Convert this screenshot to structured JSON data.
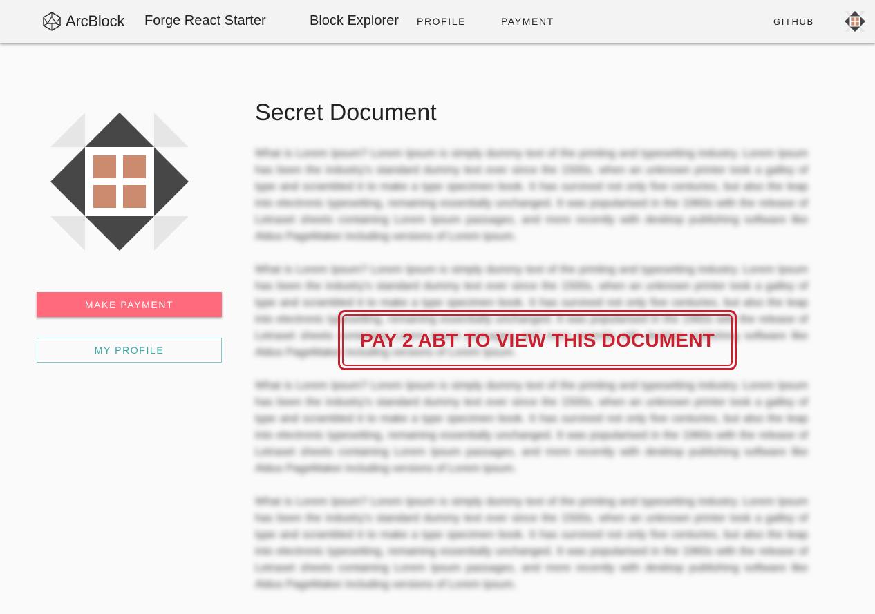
{
  "header": {
    "brand": "ArcBlock",
    "app_title": "Forge React Starter",
    "nav": {
      "explorer": "Block Explorer",
      "profile": "PROFILE",
      "payment": "PAYMENT",
      "github": "GITHUB"
    }
  },
  "colors": {
    "avatar_dark": "#474747",
    "avatar_light": "#e6e6e6",
    "avatar_accent": "#cc8a6e",
    "primary_button": "#ff6b7c",
    "outline_button": "#7ccaca",
    "stamp": "#c8202f"
  },
  "sidebar": {
    "make_payment": "MAKE PAYMENT",
    "my_profile": "MY PROFILE"
  },
  "document": {
    "title": "Secret Document",
    "paragraphs": [
      "What is Lorem Ipsum? Lorem Ipsum is simply dummy text of the printing and typesetting industry. Lorem Ipsum has been the industry's standard dummy text ever since the 1500s, when an unknown printer took a galley of type and scrambled it to make a type specimen book. It has survived not only five centuries, but also the leap into electronic typesetting, remaining essentially unchanged. It was popularised in the 1960s with the release of Letraset sheets containing Lorem Ipsum passages, and more recently with desktop publishing software like Aldus PageMaker including versions of Lorem Ipsum.",
      "What is Lorem Ipsum? Lorem Ipsum is simply dummy text of the printing and typesetting industry. Lorem Ipsum has been the industry's standard dummy text ever since the 1500s, when an unknown printer took a galley of type and scrambled it to make a type specimen book. It has survived not only five centuries, but also the leap into electronic typesetting, remaining essentially unchanged. It was popularised in the 1960s with the release of Letraset sheets containing Lorem Ipsum passages, and more recently with desktop publishing software like Aldus PageMaker including versions of Lorem Ipsum.",
      "What is Lorem Ipsum? Lorem Ipsum is simply dummy text of the printing and typesetting industry. Lorem Ipsum has been the industry's standard dummy text ever since the 1500s, when an unknown printer took a galley of type and scrambled it to make a type specimen book. It has survived not only five centuries, but also the leap into electronic typesetting, remaining essentially unchanged. It was popularised in the 1960s with the release of Letraset sheets containing Lorem Ipsum passages, and more recently with desktop publishing software like Aldus PageMaker including versions of Lorem Ipsum.",
      "What is Lorem Ipsum? Lorem Ipsum is simply dummy text of the printing and typesetting industry. Lorem Ipsum has been the industry's standard dummy text ever since the 1500s, when an unknown printer took a galley of type and scrambled it to make a type specimen book. It has survived not only five centuries, but also the leap into electronic typesetting, remaining essentially unchanged. It was popularised in the 1960s with the release of Letraset sheets containing Lorem Ipsum passages, and more recently with desktop publishing software like Aldus PageMaker including versions of Lorem Ipsum."
    ],
    "paywall_stamp": "PAY 2 ABT TO VIEW THIS DOCUMENT"
  }
}
